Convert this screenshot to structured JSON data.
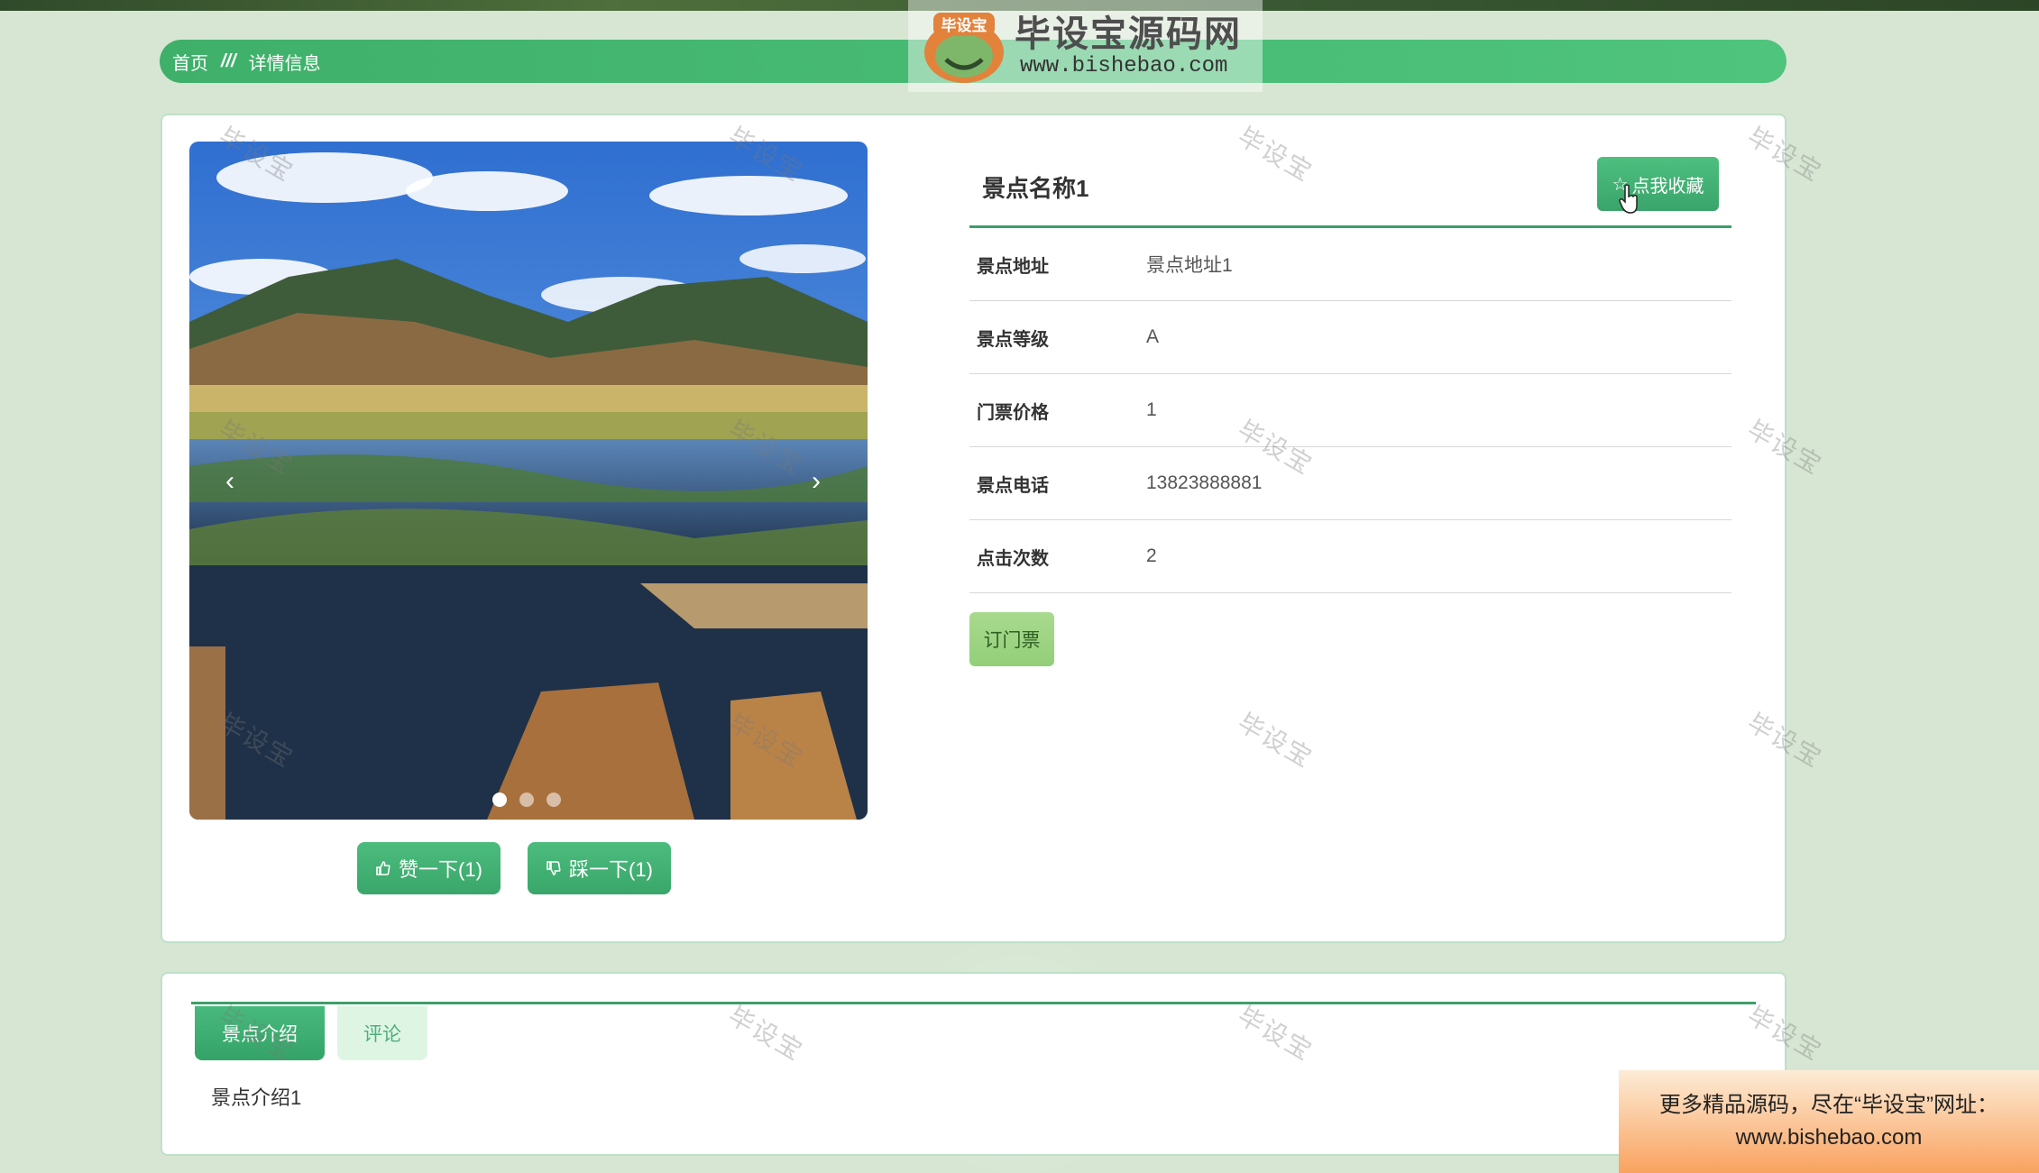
{
  "breadcrumb": {
    "home": "首页",
    "separator": "///",
    "current": "详情信息"
  },
  "logo": {
    "badge_text": "毕设宝",
    "title": "毕设宝源码网",
    "url": "www.bishebao.com"
  },
  "watermark": "毕设宝",
  "carousel": {
    "prev": "‹",
    "next": "›",
    "dot_count": 3,
    "active_dot": 0
  },
  "votes": {
    "like": "赞一下(1)",
    "dislike": "踩一下(1)"
  },
  "detail": {
    "name": "景点名称1",
    "favorite_button": "点我收藏",
    "rows": [
      {
        "label": "景点地址",
        "value": "景点地址1"
      },
      {
        "label": "景点等级",
        "value": "A"
      },
      {
        "label": "门票价格",
        "value": "1"
      },
      {
        "label": "景点电话",
        "value": "13823888881"
      },
      {
        "label": "点击次数",
        "value": "2"
      }
    ],
    "ticket_button": "订门票"
  },
  "tabs": [
    {
      "label": "景点介绍",
      "active": true
    },
    {
      "label": "评论",
      "active": false
    }
  ],
  "intro_text": "景点介绍1",
  "ad": {
    "line1": "更多精品源码，尽在“毕设宝”网址：",
    "line2": "www.bishebao.com"
  },
  "colors": {
    "primary_green": "#3fb06a",
    "tab_line": "#3e9f6a",
    "ticket_green": "#9fd585",
    "ad_orange": "#f9a25f"
  }
}
